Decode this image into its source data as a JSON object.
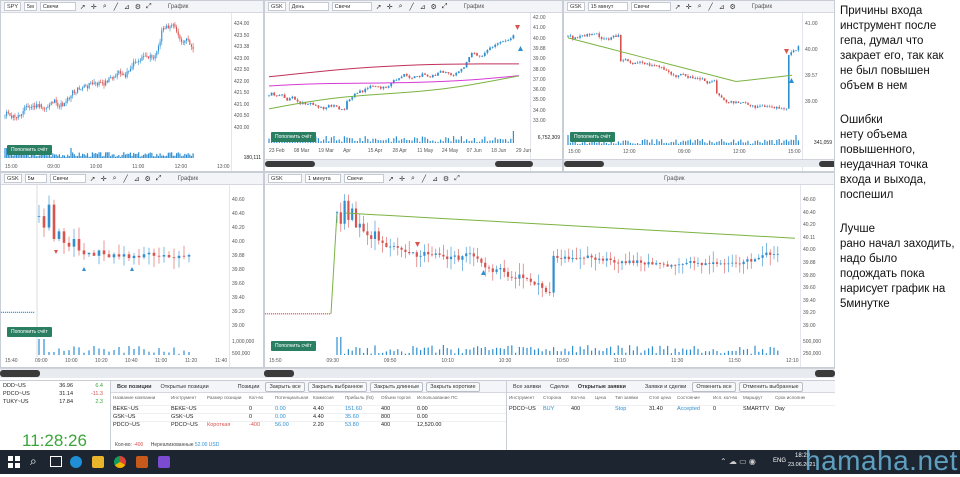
{
  "panes": {
    "spy": {
      "ticker": "SPY",
      "timeframe": "5м",
      "chart_type": "Свечи",
      "label": "График",
      "yticks": [
        "424.00",
        "423.50",
        "423.38",
        "423.00",
        "422.50",
        "422.00",
        "421.50",
        "421.00",
        "420.50",
        "420.00"
      ],
      "xticks": [
        "15:00",
        "09:00",
        "10:00",
        "11:00",
        "12:00",
        "13:00"
      ],
      "volume_label": "180,111",
      "deposit_button": "Пополнить счёт"
    },
    "gsk_day": {
      "ticker": "GSK",
      "timeframe": "День",
      "chart_type": "Свечи",
      "label": "График",
      "yticks": [
        "42.00",
        "41.00",
        "40.00",
        "39.88",
        "39.00",
        "38.00",
        "37.00",
        "36.00",
        "35.00",
        "34.00",
        "33.00"
      ],
      "xticks": [
        "23 Feb",
        "08 Mar",
        "19 Mar",
        "Apr",
        "15 Apr",
        "28 Apr",
        "11 May",
        "24 May",
        "07 Jun",
        "18 Jun",
        "29 Jun"
      ],
      "volume_label": "6,752,309",
      "deposit_button": "Пополнить счёт"
    },
    "gsk_15": {
      "ticker": "GSK",
      "timeframe": "15 минут",
      "chart_type": "Свечи",
      "label": "График",
      "yticks": [
        "41.00",
        "40.00",
        "39.57",
        "39.00"
      ],
      "xticks": [
        "15:00",
        "12:00",
        "09:00",
        "12:00",
        "15:00"
      ],
      "volume_label": "341,059",
      "deposit_button": "Пополнить счёт"
    },
    "gsk_5": {
      "ticker": "GSK",
      "timeframe": "5м",
      "chart_type": "Свечи",
      "label": "График",
      "yticks": [
        "40.60",
        "40.40",
        "40.20",
        "40.00",
        "39.88",
        "39.80",
        "39.60",
        "39.40",
        "39.20",
        "39.00"
      ],
      "xticks": [
        "15:40",
        "09:00",
        "10:00",
        "10:20",
        "10:40",
        "11:00",
        "11:20",
        "11:40"
      ],
      "volume_label": "64,407",
      "volume_ticks": [
        "1,000,000",
        "500,000"
      ],
      "deposit_button": "Пополнить счёт"
    },
    "gsk_1": {
      "ticker": "GSK",
      "timeframe": "1 минута",
      "chart_type": "Свечи",
      "label": "График",
      "yticks": [
        "40.60",
        "40.40",
        "40.20",
        "40.11",
        "40.00",
        "39.88",
        "39.80",
        "39.60",
        "39.40",
        "39.20",
        "39.00"
      ],
      "xticks": [
        "15:50",
        "09:30",
        "09:50",
        "10:10",
        "10:30",
        "10:50",
        "11:10",
        "11:30",
        "11:50",
        "12:10"
      ],
      "volume_label": "7,138",
      "volume_ticks": [
        "500,000",
        "250,000"
      ],
      "deposit_button": "Пополнить счёт"
    }
  },
  "notes": {
    "reasons": "Причины входа\nинструмент после\nгепа, думал что\nзакрает его, так как\nне был повышен\nобъем в нем",
    "errors": "Ошибки\nнету объема\nповышенного,\nнеудачная точка\nвхода и выхода,\nпоспешил",
    "better": "Лучше\nрано начал заходить,\nнадо было\nподождать пока\nнарисует график на\n5минутке"
  },
  "watchlist": {
    "rows": [
      [
        "DDD~US",
        "36.96",
        "6.4"
      ],
      [
        "PDCO~US",
        "31.14",
        "-11.3"
      ],
      [
        "TUKY~US",
        "17.84",
        "2.3"
      ]
    ],
    "clock": "11:28:26"
  },
  "positions": {
    "tabs": [
      "Все позиции",
      "Открытые позиции"
    ],
    "section_label": "Позиции",
    "buttons": [
      "Закрыть все",
      "Закрыть выбранное",
      "Закрыть длинные",
      "Закрыть короткие"
    ],
    "headers": [
      "Название компании",
      "Инструмент",
      "Размер позиции",
      "Кол-во",
      "Потенциальная",
      "Комиссия",
      "Прибыль (fst)",
      "Объем торгов",
      "Использование ПС"
    ],
    "rows": [
      [
        "BEKE~US",
        "BEKE~US",
        "",
        "0",
        "0.00",
        "4.40",
        "151.60",
        "400",
        "0.00"
      ],
      [
        "GSK~US",
        "GSK~US",
        "",
        "0",
        "0.00",
        "4.40",
        "35.60",
        "800",
        "0.00"
      ],
      [
        "PDCO~US",
        "PDCO~US",
        "Короткая",
        "-400",
        "56.00",
        "2.20",
        "53.80",
        "400",
        "12,520.00"
      ]
    ],
    "footer_qty_label": "Кол-во:",
    "footer_qty": "-400",
    "footer_unreal_label": "Нереализованные",
    "footer_unreal": "52.00 USD"
  },
  "orders": {
    "tabs": [
      "Все заявки",
      "Сделки",
      "Открытые заявки"
    ],
    "section_label": "Заявки и сделки",
    "buttons": [
      "Отменить все",
      "Отменить выбранные"
    ],
    "headers": [
      "Инструмент",
      "Сторона",
      "Кол-во",
      "Цена",
      "Тип заявки",
      "Стоп цена",
      "Состояние",
      "Исп. кол-во",
      "Маршрут",
      "Срок исполнения"
    ],
    "rows": [
      [
        "PDCO~US",
        "BUY",
        "400",
        "",
        "Stop",
        "31.40",
        "Accepted",
        "0",
        "SMARTTV",
        "Day"
      ]
    ]
  },
  "taskbar": {
    "lang": "ENG",
    "time": "18:29",
    "date": "23.06.2021"
  },
  "watermark": "hamaha.net",
  "colors": {
    "up": "#2f8fd1",
    "down": "#d9534f",
    "sma_green": "#7cb342",
    "sma_red": "#c0305a",
    "sma_magenta": "#d63bd6",
    "deposit": "#2a7f62",
    "clock": "#3aa63a"
  }
}
